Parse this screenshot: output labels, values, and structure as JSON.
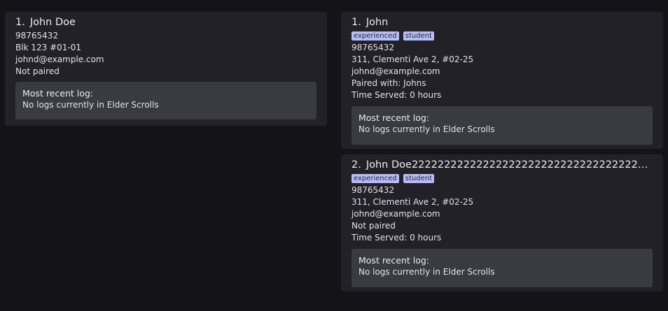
{
  "left_list": {
    "cards": [
      {
        "index": "1.",
        "name": "John Doe",
        "phone": "98765432",
        "address": "Blk 123 #01-01",
        "email": "johnd@example.com",
        "pairing": "Not paired",
        "log_title": "Most recent log:",
        "log_body": "No logs currently in Elder Scrolls"
      }
    ]
  },
  "right_list": {
    "cards": [
      {
        "index": "1.",
        "name": "John",
        "tags": [
          "experienced",
          "student"
        ],
        "phone": "98765432",
        "address": "311, Clementi Ave 2, #02-25",
        "email": "johnd@example.com",
        "pairing": "Paired with: Johns",
        "time_served": "Time Served: 0 hours",
        "log_title": "Most recent log:",
        "log_body": "No logs currently in Elder Scrolls"
      },
      {
        "index": "2.",
        "name": "John Doe22222222222222222222222222222222222222222…",
        "tags": [
          "experienced",
          "student"
        ],
        "phone": "98765432",
        "address": "311, Clementi Ave 2, #02-25",
        "email": "johnd@example.com",
        "pairing": "Not paired",
        "time_served": "Time Served: 0 hours",
        "log_title": "Most recent log:",
        "log_body": "No logs currently in Elder Scrolls"
      }
    ]
  },
  "colors": {
    "background": "#131318",
    "card": "#212127",
    "log_panel": "#3a3a41",
    "tag_bg": "#b7bdf5",
    "tag_text": "#25283f"
  }
}
